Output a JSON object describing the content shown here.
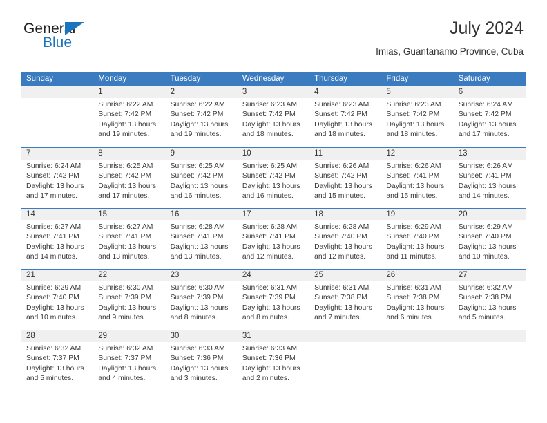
{
  "brand": {
    "name_part1": "General",
    "name_part2": "Blue",
    "triangle_icon": "triangle-icon",
    "color_dark": "#231f20",
    "color_blue": "#1b74bd"
  },
  "header": {
    "title": "July 2024",
    "subtitle": "Imias, Guantanamo Province, Cuba"
  },
  "theme": {
    "header_blue": "#3b7cc0",
    "day_band_gray": "#f0f0f0",
    "text": "#333333"
  },
  "calendar": {
    "weekday_headers": [
      "Sunday",
      "Monday",
      "Tuesday",
      "Wednesday",
      "Thursday",
      "Friday",
      "Saturday"
    ],
    "weeks": [
      [
        {
          "day": "",
          "lines": []
        },
        {
          "day": "1",
          "lines": [
            "Sunrise: 6:22 AM",
            "Sunset: 7:42 PM",
            "Daylight: 13 hours",
            "and 19 minutes."
          ]
        },
        {
          "day": "2",
          "lines": [
            "Sunrise: 6:22 AM",
            "Sunset: 7:42 PM",
            "Daylight: 13 hours",
            "and 19 minutes."
          ]
        },
        {
          "day": "3",
          "lines": [
            "Sunrise: 6:23 AM",
            "Sunset: 7:42 PM",
            "Daylight: 13 hours",
            "and 18 minutes."
          ]
        },
        {
          "day": "4",
          "lines": [
            "Sunrise: 6:23 AM",
            "Sunset: 7:42 PM",
            "Daylight: 13 hours",
            "and 18 minutes."
          ]
        },
        {
          "day": "5",
          "lines": [
            "Sunrise: 6:23 AM",
            "Sunset: 7:42 PM",
            "Daylight: 13 hours",
            "and 18 minutes."
          ]
        },
        {
          "day": "6",
          "lines": [
            "Sunrise: 6:24 AM",
            "Sunset: 7:42 PM",
            "Daylight: 13 hours",
            "and 17 minutes."
          ]
        }
      ],
      [
        {
          "day": "7",
          "lines": [
            "Sunrise: 6:24 AM",
            "Sunset: 7:42 PM",
            "Daylight: 13 hours",
            "and 17 minutes."
          ]
        },
        {
          "day": "8",
          "lines": [
            "Sunrise: 6:25 AM",
            "Sunset: 7:42 PM",
            "Daylight: 13 hours",
            "and 17 minutes."
          ]
        },
        {
          "day": "9",
          "lines": [
            "Sunrise: 6:25 AM",
            "Sunset: 7:42 PM",
            "Daylight: 13 hours",
            "and 16 minutes."
          ]
        },
        {
          "day": "10",
          "lines": [
            "Sunrise: 6:25 AM",
            "Sunset: 7:42 PM",
            "Daylight: 13 hours",
            "and 16 minutes."
          ]
        },
        {
          "day": "11",
          "lines": [
            "Sunrise: 6:26 AM",
            "Sunset: 7:42 PM",
            "Daylight: 13 hours",
            "and 15 minutes."
          ]
        },
        {
          "day": "12",
          "lines": [
            "Sunrise: 6:26 AM",
            "Sunset: 7:41 PM",
            "Daylight: 13 hours",
            "and 15 minutes."
          ]
        },
        {
          "day": "13",
          "lines": [
            "Sunrise: 6:26 AM",
            "Sunset: 7:41 PM",
            "Daylight: 13 hours",
            "and 14 minutes."
          ]
        }
      ],
      [
        {
          "day": "14",
          "lines": [
            "Sunrise: 6:27 AM",
            "Sunset: 7:41 PM",
            "Daylight: 13 hours",
            "and 14 minutes."
          ]
        },
        {
          "day": "15",
          "lines": [
            "Sunrise: 6:27 AM",
            "Sunset: 7:41 PM",
            "Daylight: 13 hours",
            "and 13 minutes."
          ]
        },
        {
          "day": "16",
          "lines": [
            "Sunrise: 6:28 AM",
            "Sunset: 7:41 PM",
            "Daylight: 13 hours",
            "and 13 minutes."
          ]
        },
        {
          "day": "17",
          "lines": [
            "Sunrise: 6:28 AM",
            "Sunset: 7:41 PM",
            "Daylight: 13 hours",
            "and 12 minutes."
          ]
        },
        {
          "day": "18",
          "lines": [
            "Sunrise: 6:28 AM",
            "Sunset: 7:40 PM",
            "Daylight: 13 hours",
            "and 12 minutes."
          ]
        },
        {
          "day": "19",
          "lines": [
            "Sunrise: 6:29 AM",
            "Sunset: 7:40 PM",
            "Daylight: 13 hours",
            "and 11 minutes."
          ]
        },
        {
          "day": "20",
          "lines": [
            "Sunrise: 6:29 AM",
            "Sunset: 7:40 PM",
            "Daylight: 13 hours",
            "and 10 minutes."
          ]
        }
      ],
      [
        {
          "day": "21",
          "lines": [
            "Sunrise: 6:29 AM",
            "Sunset: 7:40 PM",
            "Daylight: 13 hours",
            "and 10 minutes."
          ]
        },
        {
          "day": "22",
          "lines": [
            "Sunrise: 6:30 AM",
            "Sunset: 7:39 PM",
            "Daylight: 13 hours",
            "and 9 minutes."
          ]
        },
        {
          "day": "23",
          "lines": [
            "Sunrise: 6:30 AM",
            "Sunset: 7:39 PM",
            "Daylight: 13 hours",
            "and 8 minutes."
          ]
        },
        {
          "day": "24",
          "lines": [
            "Sunrise: 6:31 AM",
            "Sunset: 7:39 PM",
            "Daylight: 13 hours",
            "and 8 minutes."
          ]
        },
        {
          "day": "25",
          "lines": [
            "Sunrise: 6:31 AM",
            "Sunset: 7:38 PM",
            "Daylight: 13 hours",
            "and 7 minutes."
          ]
        },
        {
          "day": "26",
          "lines": [
            "Sunrise: 6:31 AM",
            "Sunset: 7:38 PM",
            "Daylight: 13 hours",
            "and 6 minutes."
          ]
        },
        {
          "day": "27",
          "lines": [
            "Sunrise: 6:32 AM",
            "Sunset: 7:38 PM",
            "Daylight: 13 hours",
            "and 5 minutes."
          ]
        }
      ],
      [
        {
          "day": "28",
          "lines": [
            "Sunrise: 6:32 AM",
            "Sunset: 7:37 PM",
            "Daylight: 13 hours",
            "and 5 minutes."
          ]
        },
        {
          "day": "29",
          "lines": [
            "Sunrise: 6:32 AM",
            "Sunset: 7:37 PM",
            "Daylight: 13 hours",
            "and 4 minutes."
          ]
        },
        {
          "day": "30",
          "lines": [
            "Sunrise: 6:33 AM",
            "Sunset: 7:36 PM",
            "Daylight: 13 hours",
            "and 3 minutes."
          ]
        },
        {
          "day": "31",
          "lines": [
            "Sunrise: 6:33 AM",
            "Sunset: 7:36 PM",
            "Daylight: 13 hours",
            "and 2 minutes."
          ]
        },
        {
          "day": "",
          "lines": []
        },
        {
          "day": "",
          "lines": []
        },
        {
          "day": "",
          "lines": []
        }
      ]
    ]
  }
}
